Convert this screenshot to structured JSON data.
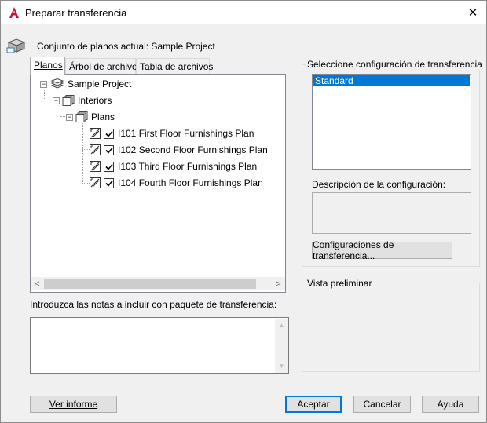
{
  "window": {
    "title": "Preparar transferencia",
    "close_glyph": "✕"
  },
  "header": {
    "current_set_label": "Conjunto de planos actual: Sample Project"
  },
  "tabs": [
    {
      "label": "Planos",
      "active": true
    },
    {
      "label": "Árbol de archivos",
      "active": false
    },
    {
      "label": "Tabla de archivos",
      "active": false
    }
  ],
  "tree": {
    "root": "Sample Project",
    "subset1": "Interiors",
    "subset2": "Plans",
    "sheets": [
      {
        "label": "I101 First Floor Furnishings Plan",
        "checked": true
      },
      {
        "label": "I102 Second Floor Furnishings Plan",
        "checked": true
      },
      {
        "label": "I103 Third Floor Furnishings Plan",
        "checked": true
      },
      {
        "label": "I104 Fourth Floor Furnishings Plan",
        "checked": true
      }
    ]
  },
  "notes": {
    "label": "Introduzca las notas a incluir con paquete de transferencia:",
    "value": ""
  },
  "config": {
    "group_label": "Seleccione configuración de transferencia",
    "items": [
      "Standard"
    ],
    "selected": "Standard",
    "description_label": "Descripción de la configuración:",
    "description_value": "",
    "button_label": "Configuraciones de transferencia..."
  },
  "preview": {
    "group_label": "Vista preliminar"
  },
  "footer": {
    "view_report": "Ver informe",
    "ok": "Aceptar",
    "cancel": "Cancelar",
    "help": "Ayuda"
  },
  "colors": {
    "selection": "#0078d7",
    "app_icon": "#c8102e"
  },
  "icons": {
    "app": "autocad-logo-icon",
    "header": "transmittal-package-icon",
    "sheet_set": "sheet-set-icon",
    "subset": "subset-icon",
    "sheet": "sheet-icon"
  }
}
